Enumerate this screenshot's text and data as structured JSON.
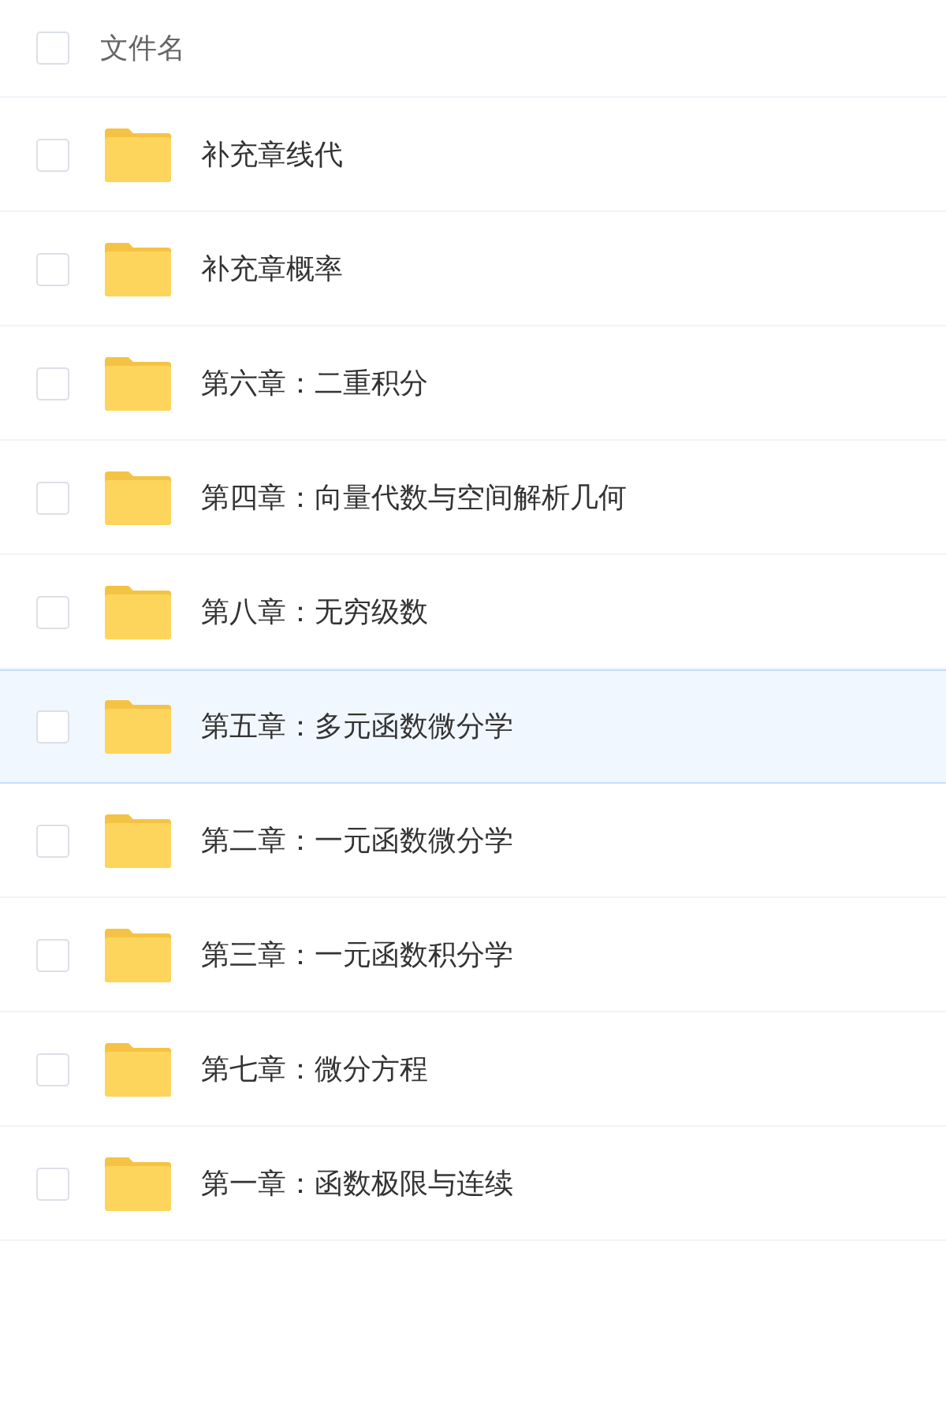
{
  "header": {
    "checked": false,
    "label": "文件名"
  },
  "files": [
    {
      "name": "补充章线代",
      "checked": false,
      "selected": false
    },
    {
      "name": "补充章概率",
      "checked": false,
      "selected": false
    },
    {
      "name": "第六章：二重积分",
      "checked": false,
      "selected": false
    },
    {
      "name": "第四章：向量代数与空间解析几何",
      "checked": false,
      "selected": false
    },
    {
      "name": "第八章：无穷级数",
      "checked": false,
      "selected": false
    },
    {
      "name": "第五章：多元函数微分学",
      "checked": false,
      "selected": true
    },
    {
      "name": "第二章：一元函数微分学",
      "checked": false,
      "selected": false
    },
    {
      "name": "第三章：一元函数积分学",
      "checked": false,
      "selected": false
    },
    {
      "name": "第七章：微分方程",
      "checked": false,
      "selected": false
    },
    {
      "name": "第一章：函数极限与连续",
      "checked": false,
      "selected": false
    }
  ]
}
